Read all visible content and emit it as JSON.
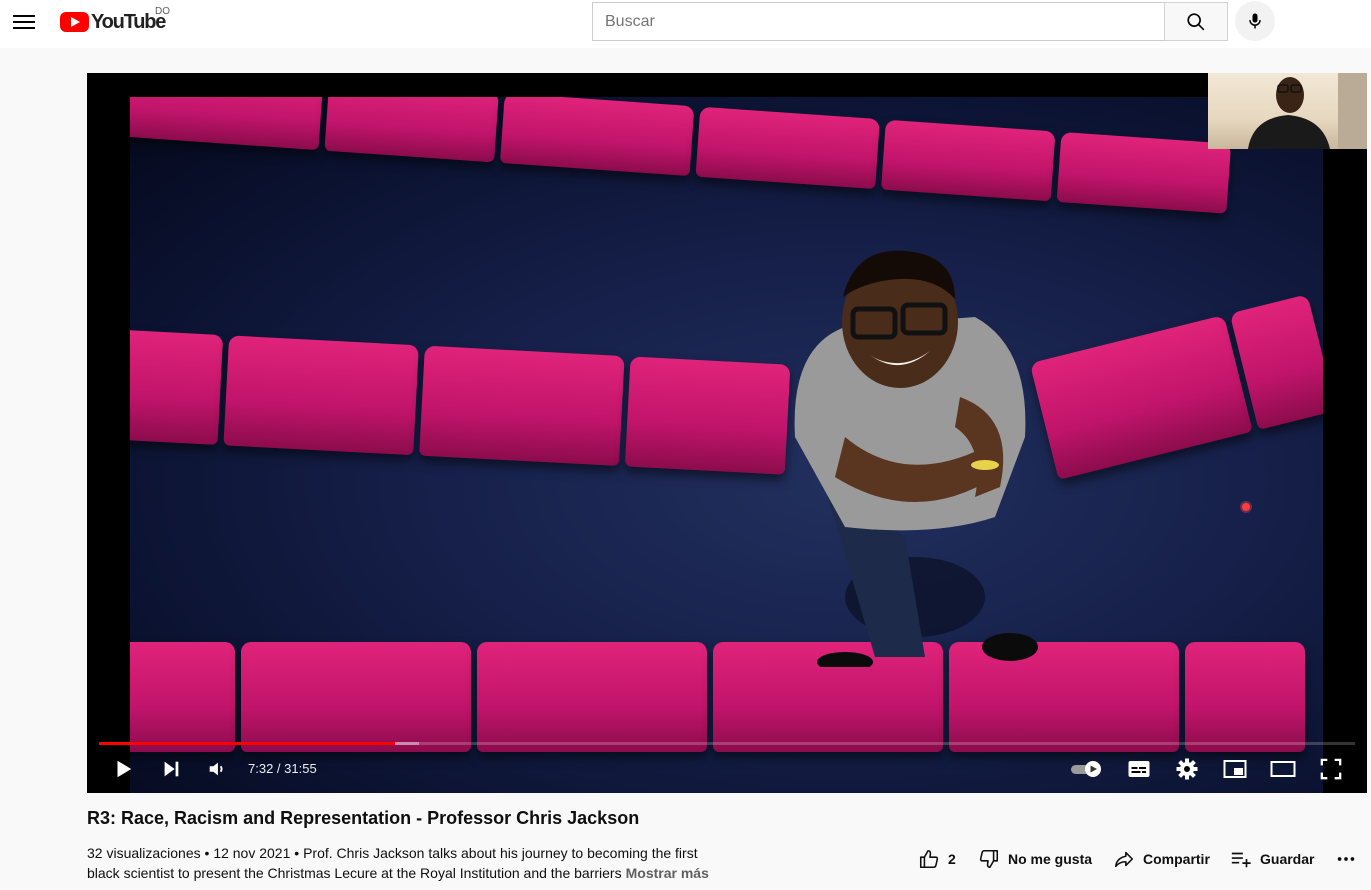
{
  "masthead": {
    "logo_text": "YouTube",
    "country_code": "DO",
    "search_placeholder": "Buscar"
  },
  "player": {
    "current_time": "7:32",
    "duration": "31:55",
    "time_display": "7:32 / 31:55",
    "played_fraction": 0.236,
    "buffered_fraction": 0.255
  },
  "video": {
    "title": "R3: Race, Racism and Representation - Professor Chris Jackson",
    "views": "32 visualizaciones",
    "date": "12 nov 2021",
    "description_line1": "Prof. Chris Jackson talks about his journey to becoming the first",
    "description_line2": "black scientist to present the Christmas Lecure at the Royal Institution and the barriers",
    "show_more": "Mostrar más"
  },
  "actions": {
    "like_count": "2",
    "dislike_label": "No me gusta",
    "share_label": "Compartir",
    "save_label": "Guardar"
  },
  "colors": {
    "accent": "#ff0000",
    "seat_magenta": "#c0146a",
    "carpet_blue": "#16204a"
  }
}
